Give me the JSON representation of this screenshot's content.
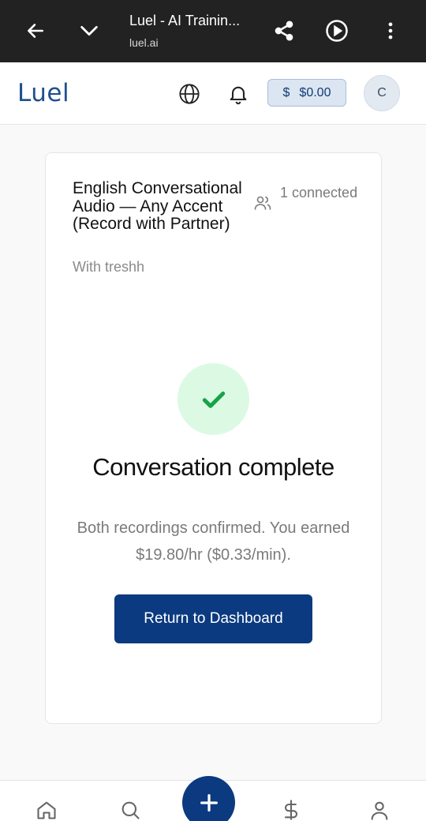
{
  "browser": {
    "page_title": "Luel - AI Trainin...",
    "url": "luel.ai",
    "icons": [
      "back-arrow-icon",
      "chevron-down-icon",
      "share-icon",
      "play-icon",
      "more-vertical-icon"
    ]
  },
  "header": {
    "logo_text": "Luel",
    "balance_symbol": "$",
    "balance": "$0.00",
    "avatar_initial": "C",
    "icons": [
      "globe-icon",
      "bell-icon"
    ]
  },
  "task": {
    "title": "English Conversational Audio — Any Accent (Record with Partner)",
    "partner": "With treshh",
    "connected": "1 connected"
  },
  "completion": {
    "heading": "Conversation complete",
    "message": "Both recordings confirmed. You earned $19.80/hr ($0.33/min).",
    "button_label": "Return to Dashboard"
  },
  "bottom_nav": {
    "items": [
      "home-icon",
      "search-icon",
      "plus-icon",
      "dollar-icon",
      "profile-icon"
    ]
  },
  "colors": {
    "primary": "#0b3a80",
    "success": "#16a34a",
    "success_bg": "#dcf9e4",
    "chrome_bg": "#222222"
  }
}
